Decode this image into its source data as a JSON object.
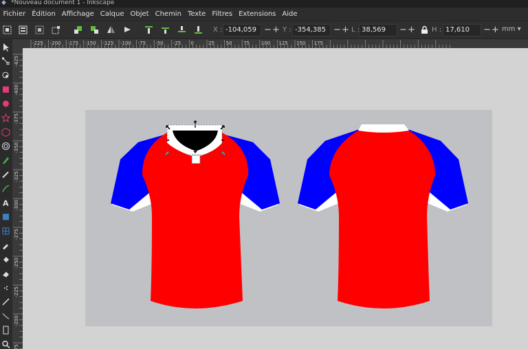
{
  "window": {
    "title": "*Nouveau document 1 - Inkscape"
  },
  "menu": [
    "Fichier",
    "Édition",
    "Affichage",
    "Calque",
    "Objet",
    "Chemin",
    "Texte",
    "Filtres",
    "Extensions",
    "Aide"
  ],
  "controls": {
    "x_label": "X :",
    "x_value": "-104,059",
    "y_label": "Y :",
    "y_value": "-354,385",
    "w_label": "L :",
    "w_value": "38,569",
    "h_label": "H :",
    "h_value": "17,610",
    "unit": "mm ▾",
    "minus": "−",
    "plus": "+"
  },
  "ruler": {
    "h_ticks": [
      "-225",
      "-200",
      "-175",
      "-150",
      "-125",
      "-100",
      "-75",
      "-50",
      "-25",
      "0",
      "25",
      "50",
      "75",
      "100",
      "125",
      "150",
      "175"
    ],
    "v_ticks": [
      "-425",
      "-400",
      "-375",
      "-350",
      "-325",
      "-300",
      "-275",
      "-250",
      "-225",
      "-200",
      "-175"
    ]
  },
  "colors": {
    "jersey_red": "#ff0000",
    "sleeve_blue": "#0000ff",
    "collar_white": "#ffffff",
    "collar_black": "#000000",
    "page_bg": "#c0c1c5",
    "canvas_bg": "#d3d3d3"
  },
  "icons": {
    "toolbox": [
      "selector-tool-icon",
      "node-tool-icon",
      "tweak-tool-icon",
      "rectangle-tool-icon",
      "ellipse-tool-icon",
      "star-tool-icon",
      "box3d-tool-icon",
      "spiral-tool-icon",
      "pen-tool-icon",
      "pencil-tool-icon",
      "calligraphy-tool-icon",
      "text-tool-icon",
      "gradient-tool-icon",
      "mesh-tool-icon",
      "dropper-tool-icon",
      "paint-bucket-tool-icon",
      "eraser-tool-icon",
      "spray-tool-icon",
      "measure-tool-icon",
      "connector-tool-icon",
      "page-tool-icon",
      "zoom-tool-icon"
    ]
  }
}
